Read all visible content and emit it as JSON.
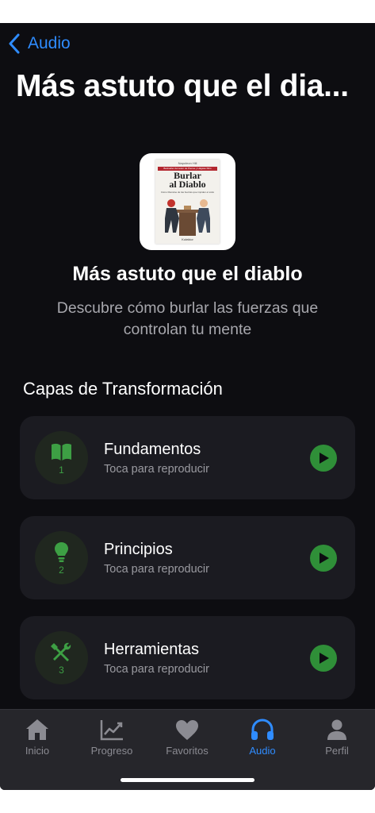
{
  "nav": {
    "back_label": "Audio"
  },
  "page_title": "Más astuto que el dia...",
  "cover": {
    "author": "Napoleon Hill",
    "band": "Bestseller del autor de Piense y Hágase Rico",
    "title": "Burlar\nal Diablo",
    "subtitle": "Cómo liberarse de las fuerzas que impiden el éxito",
    "publisher": "Kolektor"
  },
  "hero": {
    "title": "Más astuto que el diablo",
    "subtitle": "Descubre cómo burlar las fuerzas que controlan tu mente"
  },
  "section_title": "Capas de Transformación",
  "layers": [
    {
      "icon": "book-icon",
      "number": "1",
      "title": "Fundamentos",
      "subtitle": "Toca para reproducir"
    },
    {
      "icon": "lightbulb-icon",
      "number": "2",
      "title": "Principios",
      "subtitle": "Toca para reproducir"
    },
    {
      "icon": "tools-icon",
      "number": "3",
      "title": "Herramientas",
      "subtitle": "Toca para reproducir"
    }
  ],
  "tabs": [
    {
      "label": "Inicio",
      "icon": "house-icon",
      "active": false
    },
    {
      "label": "Progreso",
      "icon": "chart-icon",
      "active": false
    },
    {
      "label": "Favoritos",
      "icon": "heart-icon",
      "active": false
    },
    {
      "label": "Audio",
      "icon": "headphones-icon",
      "active": true
    },
    {
      "label": "Perfil",
      "icon": "person-icon",
      "active": false
    }
  ],
  "colors": {
    "accent": "#2f8cff",
    "green": "#2f8f38",
    "background": "#0d0d11",
    "card": "#1b1b21"
  }
}
